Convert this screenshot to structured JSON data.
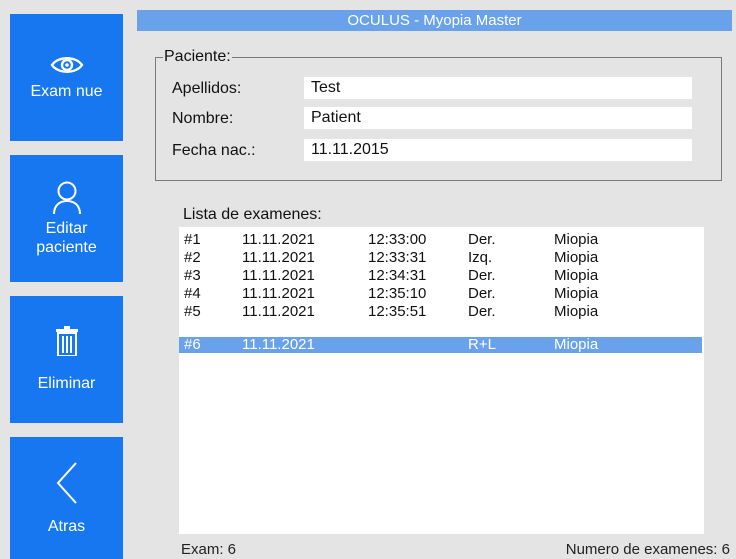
{
  "sidebar": {
    "new_exam": {
      "label": "Exam nue",
      "icon": "eye-icon"
    },
    "edit_patient": {
      "label_line1": "Editar",
      "label_line2": "paciente",
      "icon": "person-icon"
    },
    "delete": {
      "label": "Eliminar",
      "icon": "trash-icon"
    },
    "back": {
      "label": "Atras",
      "icon": "chevron-left-icon"
    }
  },
  "window_title": "OCULUS - Myopia Master",
  "patient": {
    "group_title": "Paciente:",
    "last_name_label": "Apellidos:",
    "last_name": "Test",
    "first_name_label": "Nombre:",
    "first_name": "Patient",
    "dob_label": "Fecha nac.:",
    "dob": "11.11.2015"
  },
  "exams": {
    "title": "Lista de examenes:",
    "rows": [
      {
        "id": "#1",
        "date": "11.11.2021",
        "time": "12:33:00",
        "eye": "Der.",
        "type": "Miopia"
      },
      {
        "id": "#2",
        "date": "11.11.2021",
        "time": "12:33:31",
        "eye": "Izq.",
        "type": "Miopia"
      },
      {
        "id": "#3",
        "date": "11.11.2021",
        "time": "12:34:31",
        "eye": "Der.",
        "type": "Miopia"
      },
      {
        "id": "#4",
        "date": "11.11.2021",
        "time": "12:35:10",
        "eye": "Der.",
        "type": "Miopia"
      },
      {
        "id": "#5",
        "date": "11.11.2021",
        "time": "12:35:51",
        "eye": "Der.",
        "type": "Miopia"
      },
      {
        "id": "#6",
        "date": "11.11.2021",
        "time": "",
        "eye": "R+L",
        "type": "Miopia"
      }
    ],
    "selected_index": 5
  },
  "footer": {
    "current_exam": "Exam: 6",
    "exam_count": "Numero de examenes: 6"
  },
  "colors": {
    "accent": "#1677f0",
    "selection": "#69a2ea",
    "background": "#e4e4e4"
  }
}
